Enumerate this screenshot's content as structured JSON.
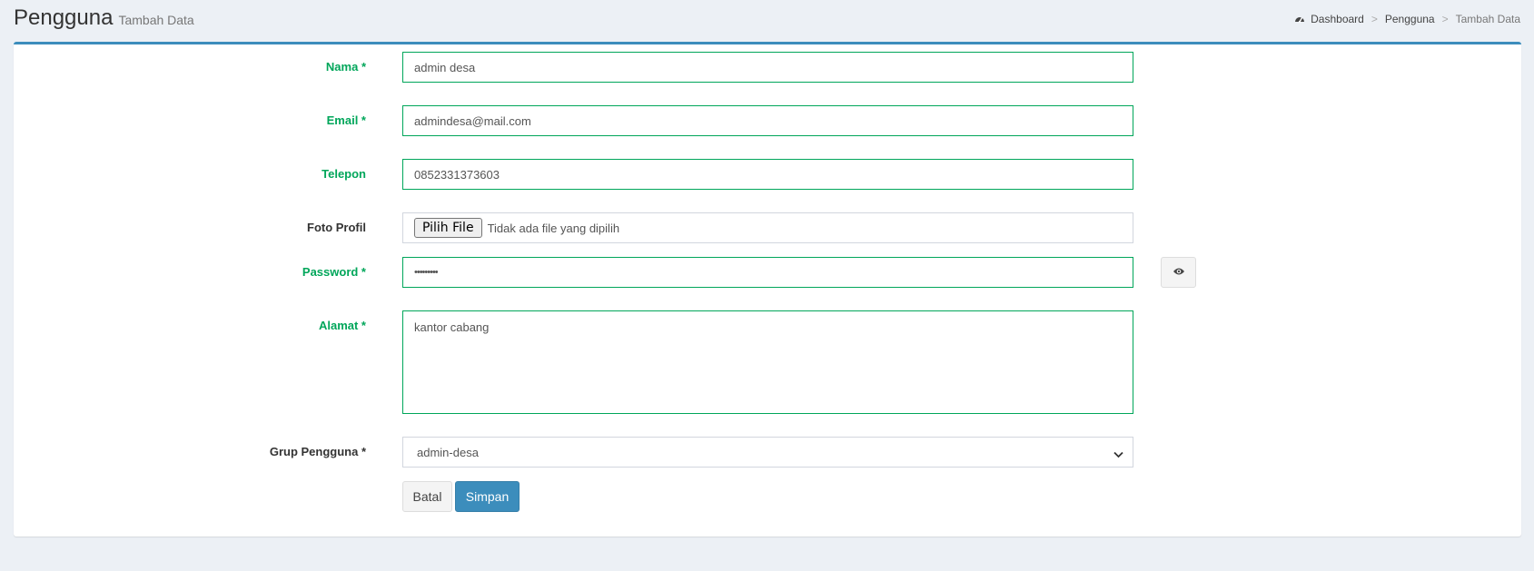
{
  "header": {
    "title": "Pengguna",
    "subtitle": "Tambah Data"
  },
  "breadcrumb": {
    "items": [
      "Dashboard",
      "Pengguna",
      "Tambah Data"
    ],
    "separator": ">"
  },
  "form": {
    "nama": {
      "label": "Nama *",
      "value": "admin desa"
    },
    "email": {
      "label": "Email *",
      "value": "admindesa@mail.com"
    },
    "telepon": {
      "label": "Telepon",
      "value": "0852331373603"
    },
    "foto": {
      "label": "Foto Profil",
      "button": "Pilih File",
      "status": "Tidak ada file yang dipilih"
    },
    "password": {
      "label": "Password *",
      "value": "•••••••••"
    },
    "alamat": {
      "label": "Alamat *",
      "value": "kantor cabang"
    },
    "grup": {
      "label": "Grup Pengguna *",
      "value": "admin-desa"
    }
  },
  "actions": {
    "cancel": "Batal",
    "save": "Simpan"
  },
  "colors": {
    "accent": "#3c8dbc",
    "valid": "#00a65a",
    "background": "#ecf0f5"
  },
  "icons": {
    "breadcrumb": "dashboard-icon",
    "password_toggle": "eye-icon",
    "select": "chevron-down-icon"
  }
}
